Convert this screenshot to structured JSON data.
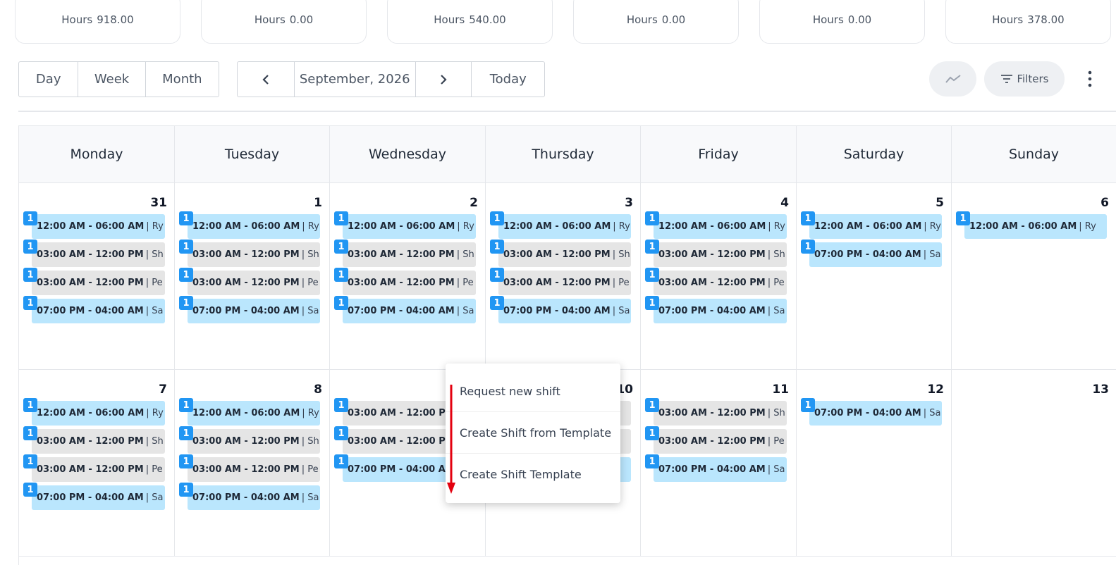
{
  "stats": [
    {
      "label": "Hours",
      "value": "918.00"
    },
    {
      "label": "Hours",
      "value": "0.00"
    },
    {
      "label": "Hours",
      "value": "540.00"
    },
    {
      "label": "Hours",
      "value": "0.00"
    },
    {
      "label": "Hours",
      "value": "0.00"
    },
    {
      "label": "Hours",
      "value": "378.00"
    }
  ],
  "view_buttons": {
    "day": "Day",
    "week": "Week",
    "month": "Month"
  },
  "nav": {
    "prev_icon": "chevron-left-icon",
    "label": "September, 2026",
    "next_icon": "chevron-right-icon",
    "today": "Today"
  },
  "toolbar": {
    "trend_icon": "trend-line-icon",
    "filters_label": "Filters",
    "filter_icon": "filter-lines-icon",
    "more_icon": "more-vertical-icon"
  },
  "weekdays": [
    "Monday",
    "Tuesday",
    "Wednesday",
    "Thursday",
    "Friday",
    "Saturday",
    "Sunday"
  ],
  "weeks": [
    [
      {
        "day": "31",
        "shifts": [
          {
            "time": "12:00 AM - 06:00 AM",
            "name": "| Ry",
            "color": "blue",
            "count": "1"
          },
          {
            "time": "03:00 AM - 12:00 PM",
            "name": "| Sh",
            "color": "grey",
            "count": "1"
          },
          {
            "time": "03:00 AM - 12:00 PM",
            "name": "| Pe",
            "color": "grey",
            "count": "1"
          },
          {
            "time": "07:00 PM - 04:00 AM",
            "name": "| Sa",
            "color": "blue",
            "count": "1"
          }
        ]
      },
      {
        "day": "1",
        "shifts": [
          {
            "time": "12:00 AM - 06:00 AM",
            "name": "| Ry",
            "color": "blue",
            "count": "1"
          },
          {
            "time": "03:00 AM - 12:00 PM",
            "name": "| Sh",
            "color": "grey",
            "count": "1"
          },
          {
            "time": "03:00 AM - 12:00 PM",
            "name": "| Pe",
            "color": "grey",
            "count": "1"
          },
          {
            "time": "07:00 PM - 04:00 AM",
            "name": "| Sa",
            "color": "blue",
            "count": "1"
          }
        ]
      },
      {
        "day": "2",
        "shifts": [
          {
            "time": "12:00 AM - 06:00 AM",
            "name": "| Ry",
            "color": "blue",
            "count": "1"
          },
          {
            "time": "03:00 AM - 12:00 PM",
            "name": "| Sh",
            "color": "grey",
            "count": "1"
          },
          {
            "time": "03:00 AM - 12:00 PM",
            "name": "| Pe",
            "color": "grey",
            "count": "1"
          },
          {
            "time": "07:00 PM - 04:00 AM",
            "name": "| Sa",
            "color": "blue",
            "count": "1"
          }
        ]
      },
      {
        "day": "3",
        "shifts": [
          {
            "time": "12:00 AM - 06:00 AM",
            "name": "| Ry",
            "color": "blue",
            "count": "1"
          },
          {
            "time": "03:00 AM - 12:00 PM",
            "name": "| Sh",
            "color": "grey",
            "count": "1"
          },
          {
            "time": "03:00 AM - 12:00 PM",
            "name": "| Pe",
            "color": "grey",
            "count": "1"
          },
          {
            "time": "07:00 PM - 04:00 AM",
            "name": "| Sa",
            "color": "blue",
            "count": "1"
          }
        ]
      },
      {
        "day": "4",
        "shifts": [
          {
            "time": "12:00 AM - 06:00 AM",
            "name": "| Ry",
            "color": "blue",
            "count": "1"
          },
          {
            "time": "03:00 AM - 12:00 PM",
            "name": "| Sh",
            "color": "grey",
            "count": "1"
          },
          {
            "time": "03:00 AM - 12:00 PM",
            "name": "| Pe",
            "color": "grey",
            "count": "1"
          },
          {
            "time": "07:00 PM - 04:00 AM",
            "name": "| Sa",
            "color": "blue",
            "count": "1"
          }
        ]
      },
      {
        "day": "5",
        "shifts": [
          {
            "time": "12:00 AM - 06:00 AM",
            "name": "| Ry",
            "color": "blue",
            "count": "1"
          },
          {
            "time": "07:00 PM - 04:00 AM",
            "name": "| Sa",
            "color": "blue",
            "count": "1"
          }
        ]
      },
      {
        "day": "6",
        "shifts": [
          {
            "time": "12:00 AM - 06:00 AM",
            "name": "| Ry",
            "color": "blue",
            "count": "1"
          }
        ]
      }
    ],
    [
      {
        "day": "7",
        "shifts": [
          {
            "time": "12:00 AM - 06:00 AM",
            "name": "| Ry",
            "color": "blue",
            "count": "1"
          },
          {
            "time": "03:00 AM - 12:00 PM",
            "name": "| Sh",
            "color": "grey",
            "count": "1"
          },
          {
            "time": "03:00 AM - 12:00 PM",
            "name": "| Pe",
            "color": "grey",
            "count": "1"
          },
          {
            "time": "07:00 PM - 04:00 AM",
            "name": "| Sa",
            "color": "blue",
            "count": "1"
          }
        ]
      },
      {
        "day": "8",
        "shifts": [
          {
            "time": "12:00 AM - 06:00 AM",
            "name": "| Ry",
            "color": "blue",
            "count": "1"
          },
          {
            "time": "03:00 AM - 12:00 PM",
            "name": "| Sh",
            "color": "grey",
            "count": "1"
          },
          {
            "time": "03:00 AM - 12:00 PM",
            "name": "| Pe",
            "color": "grey",
            "count": "1"
          },
          {
            "time": "07:00 PM - 04:00 AM",
            "name": "| Sa",
            "color": "blue",
            "count": "1"
          }
        ]
      },
      {
        "day": "",
        "shifts": [
          {
            "time": "03:00 AM - 12:00 PM",
            "name": "",
            "color": "grey",
            "count": "1"
          },
          {
            "time": "03:00 AM - 12:00 PM",
            "name": "",
            "color": "grey",
            "count": "1"
          },
          {
            "time": "07:00 PM - 04:00 AM",
            "name": "",
            "color": "blue",
            "count": "1"
          }
        ]
      },
      {
        "day": "10",
        "shifts": [
          {
            "time": "",
            "name": "",
            "color": "grey",
            "count": ""
          },
          {
            "time": "",
            "name": "",
            "color": "grey",
            "count": ""
          },
          {
            "time": "",
            "name": "",
            "color": "blue",
            "count": ""
          }
        ]
      },
      {
        "day": "11",
        "shifts": [
          {
            "time": "03:00 AM - 12:00 PM",
            "name": "| Sh",
            "color": "grey",
            "count": "1"
          },
          {
            "time": "03:00 AM - 12:00 PM",
            "name": "| Pe",
            "color": "grey",
            "count": "1"
          },
          {
            "time": "07:00 PM - 04:00 AM",
            "name": "| Sa",
            "color": "blue",
            "count": "1"
          }
        ]
      },
      {
        "day": "12",
        "shifts": [
          {
            "time": "07:00 PM - 04:00 AM",
            "name": "| Sa",
            "color": "blue",
            "count": "1"
          }
        ]
      },
      {
        "day": "13",
        "shifts": []
      }
    ]
  ],
  "context_menu": {
    "items": [
      "Request new shift",
      "Create Shift from Template",
      "Create Shift Template"
    ]
  },
  "colors": {
    "shift_blue": "#bae6fd",
    "shift_grey": "#e5e5e5",
    "badge": "#2196f3",
    "annotation_arrow": "#e3000f"
  }
}
